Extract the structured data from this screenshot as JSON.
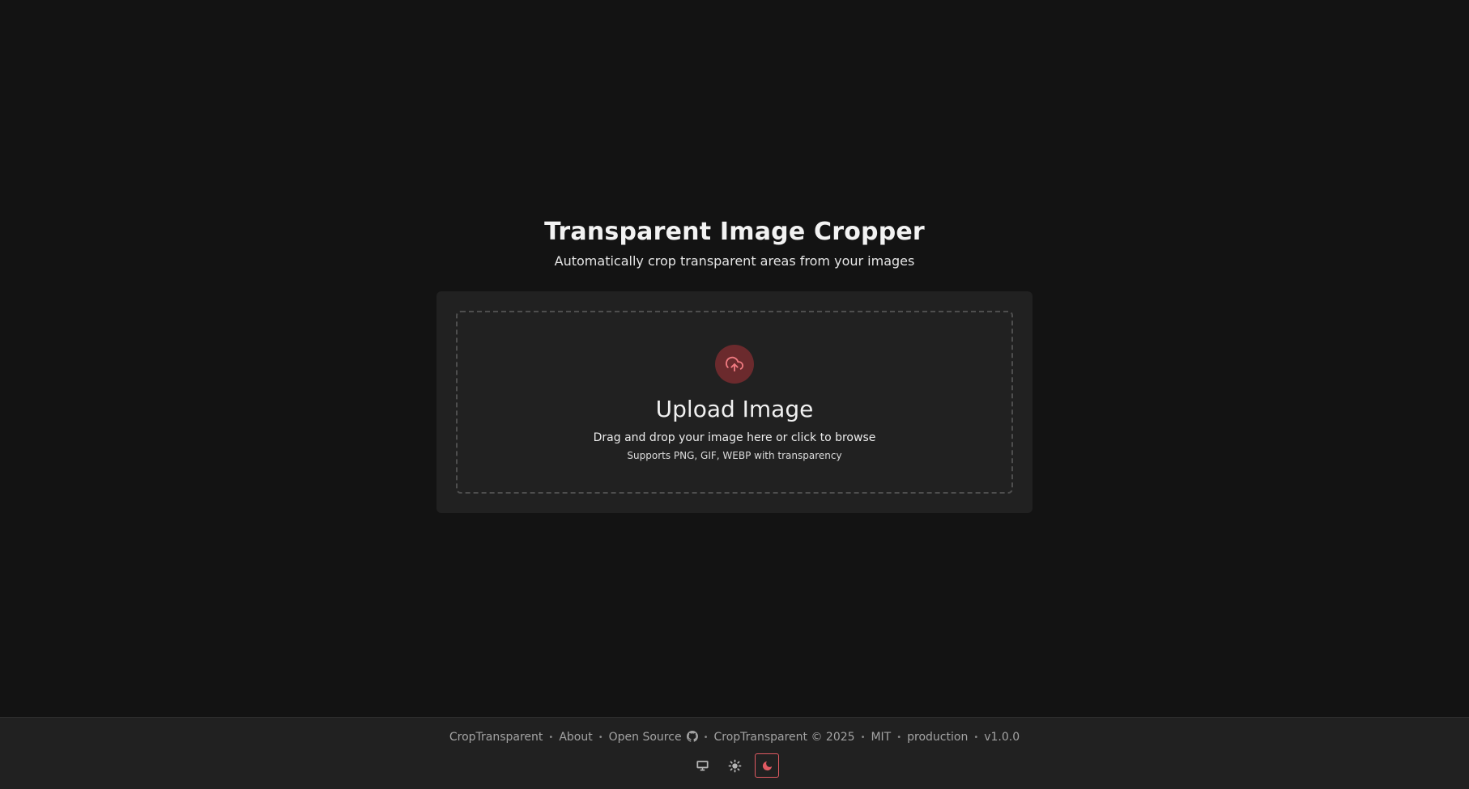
{
  "header": {
    "title": "Transparent Image Cropper",
    "subtitle": "Automatically crop transparent areas from your images"
  },
  "upload": {
    "icon": "cloud-upload-icon",
    "heading": "Upload Image",
    "description": "Drag and drop your image here or click to browse",
    "formats": "Supports PNG, GIF, WEBP with transparency"
  },
  "footer": {
    "brand": "CropTransparent",
    "about": "About",
    "open_source": "Open Source",
    "copyright": "CropTransparent © 2025",
    "license": "MIT",
    "environment": "production",
    "version": "v1.0.0",
    "separator": "•",
    "github_icon": "github-icon"
  },
  "theme_switcher": {
    "options": [
      "system",
      "light",
      "dark"
    ],
    "selected": "dark"
  },
  "colors": {
    "background": "#131313",
    "card": "#212121",
    "accent": "#e05a62",
    "accent_bg": "#6b2a2d"
  }
}
